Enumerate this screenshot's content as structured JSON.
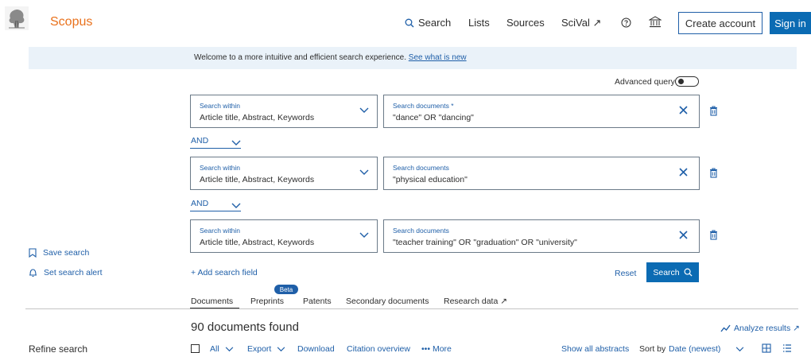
{
  "header": {
    "brand": "Scopus",
    "nav": {
      "search": "Search",
      "lists": "Lists",
      "sources": "Sources",
      "scival": "SciVal ↗"
    },
    "create_account": "Create account",
    "sign_in": "Sign in"
  },
  "banner": {
    "text": "Welcome to a more intuitive and efficient search experience.",
    "link": "See what is new"
  },
  "advanced_query": {
    "label": "Advanced query",
    "on": false
  },
  "search_rows": [
    {
      "within_label": "Search within",
      "within_value": "Article title, Abstract, Keywords",
      "docs_label": "Search documents *",
      "docs_value": "\"dance\" OR \"dancing\""
    },
    {
      "within_label": "Search within",
      "within_value": "Article title, Abstract, Keywords",
      "docs_label": "Search documents",
      "docs_value": "\"physical education\""
    },
    {
      "within_label": "Search within",
      "within_value": "Article title, Abstract, Keywords",
      "docs_label": "Search documents",
      "docs_value": "\"teacher training\" OR \"graduation\" OR \"university\""
    }
  ],
  "operators": [
    "AND",
    "AND"
  ],
  "sidebar": {
    "save_search": "Save search",
    "set_alert": "Set search alert",
    "refine": "Refine search"
  },
  "actions": {
    "add_field": "+ Add search field",
    "reset": "Reset",
    "search": "Search"
  },
  "tabs": {
    "documents": "Documents",
    "preprints": "Preprints",
    "beta": "Beta",
    "patents": "Patents",
    "secondary": "Secondary documents",
    "research_data": "Research data ↗"
  },
  "results": {
    "found": "90 documents found",
    "analyze": "Analyze results ↗"
  },
  "toolbar": {
    "all": "All",
    "export": "Export",
    "download": "Download",
    "citation": "Citation overview",
    "more": "••• More",
    "show_abstracts": "Show all abstracts",
    "sort_label": "Sort by",
    "sort_value": "Date (newest)"
  },
  "colors": {
    "brand": "#e9711c",
    "accent": "#1f5fa8",
    "primary_button": "#0b6bb3",
    "banner": "#eaf2f9"
  }
}
